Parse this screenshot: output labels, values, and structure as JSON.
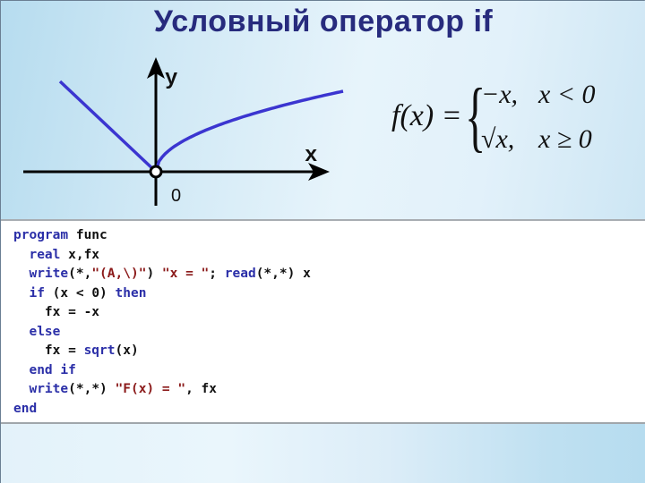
{
  "title": "Условный оператор if",
  "graph": {
    "y_axis_label": "y",
    "x_axis_label": "x",
    "origin_label": "0",
    "curve_color": "#3b35d0",
    "axis_color": "#000000",
    "branches": [
      {
        "name": "negative",
        "expression": "-x",
        "domain": "x < 0"
      },
      {
        "name": "positive",
        "expression": "sqrt(x)",
        "domain": "x >= 0"
      }
    ]
  },
  "formula": {
    "lhs": "f(x) =",
    "cases": [
      {
        "expr": "−x,",
        "cond": "x < 0"
      },
      {
        "expr": "√x,",
        "cond": "x ≥ 0"
      }
    ]
  },
  "code": {
    "keyword_color": "#2b2fa8",
    "string_color": "#8b1a1a",
    "lines": [
      [
        {
          "t": "program",
          "k": "kw"
        },
        {
          "t": " func",
          "k": ""
        }
      ],
      [
        {
          "t": "  ",
          "k": ""
        },
        {
          "t": "real",
          "k": "kw"
        },
        {
          "t": " x,fx",
          "k": ""
        }
      ],
      [
        {
          "t": "  ",
          "k": ""
        },
        {
          "t": "write",
          "k": "kw"
        },
        {
          "t": "(*,",
          "k": ""
        },
        {
          "t": "\"(A,\\)\"",
          "k": "str"
        },
        {
          "t": ") ",
          "k": ""
        },
        {
          "t": "\"x = \"",
          "k": "str"
        },
        {
          "t": "; ",
          "k": ""
        },
        {
          "t": "read",
          "k": "kw"
        },
        {
          "t": "(*,*) x",
          "k": ""
        }
      ],
      [
        {
          "t": "  ",
          "k": ""
        },
        {
          "t": "if",
          "k": "kw"
        },
        {
          "t": " (x < 0) ",
          "k": ""
        },
        {
          "t": "then",
          "k": "kw"
        }
      ],
      [
        {
          "t": "    fx = -x",
          "k": ""
        }
      ],
      [
        {
          "t": "  ",
          "k": ""
        },
        {
          "t": "else",
          "k": "kw"
        }
      ],
      [
        {
          "t": "    fx = ",
          "k": ""
        },
        {
          "t": "sqrt",
          "k": "kw"
        },
        {
          "t": "(x)",
          "k": ""
        }
      ],
      [
        {
          "t": "  ",
          "k": ""
        },
        {
          "t": "end if",
          "k": "kw"
        }
      ],
      [
        {
          "t": "  ",
          "k": ""
        },
        {
          "t": "write",
          "k": "kw"
        },
        {
          "t": "(*,*) ",
          "k": ""
        },
        {
          "t": "\"F(x) = \"",
          "k": "str"
        },
        {
          "t": ", fx",
          "k": ""
        }
      ],
      [
        {
          "t": "end",
          "k": "kw"
        }
      ]
    ]
  }
}
